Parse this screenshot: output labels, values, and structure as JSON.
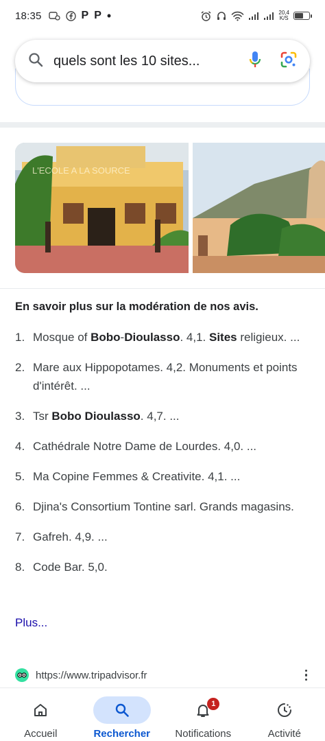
{
  "status_bar": {
    "time": "18:35",
    "app_icon_letters": [
      "P",
      "P"
    ],
    "net_speed_value": "20,4",
    "net_speed_unit": "K/S",
    "battery_level": 0.6
  },
  "search": {
    "query": "quels sont les 10 sites..."
  },
  "section": {
    "heading": "En savoir plus sur la modération de nos avis."
  },
  "results": [
    {
      "num": "1.",
      "parts": [
        {
          "t": "Mosque of "
        },
        {
          "t": "Bobo",
          "b": true
        },
        {
          "t": "-"
        },
        {
          "t": "Dioulasso",
          "b": true
        },
        {
          "t": ". 4,1. "
        },
        {
          "t": "Sites",
          "b": true
        },
        {
          "t": " religieux. ..."
        }
      ]
    },
    {
      "num": "2.",
      "parts": [
        {
          "t": "Mare aux Hippopotames. 4,2. Monuments et points d'intérêt. ..."
        }
      ]
    },
    {
      "num": "3.",
      "parts": [
        {
          "t": "Tsr "
        },
        {
          "t": "Bobo Dioulasso",
          "b": true
        },
        {
          "t": ". 4,7. ..."
        }
      ]
    },
    {
      "num": "4.",
      "parts": [
        {
          "t": "Cathédrale Notre Dame de Lourdes. 4,0. ..."
        }
      ]
    },
    {
      "num": "5.",
      "parts": [
        {
          "t": "Ma Copine Femmes & Creativite. 4,1. ..."
        }
      ]
    },
    {
      "num": "6.",
      "parts": [
        {
          "t": "Djina's Consortium Tontine sarl. Grands magasins."
        }
      ]
    },
    {
      "num": "7.",
      "parts": [
        {
          "t": "Gafreh. 4,9. ..."
        }
      ]
    },
    {
      "num": "8.",
      "parts": [
        {
          "t": "Code Bar. 5,0."
        }
      ]
    }
  ],
  "more_link": "Plus...",
  "source": {
    "url": "https://www.tripadvisor.fr",
    "favicon": "tripadvisor-owl-icon"
  },
  "bottom_nav": {
    "tabs": [
      {
        "label": "Accueil",
        "icon": "home-icon",
        "active": false
      },
      {
        "label": "Rechercher",
        "icon": "search-icon",
        "active": true
      },
      {
        "label": "Notifications",
        "icon": "bell-icon",
        "active": false,
        "badge": "1"
      },
      {
        "label": "Activité",
        "icon": "activity-icon",
        "active": false
      }
    ]
  },
  "colors": {
    "accent": "#0b57d0",
    "active_pill": "#d3e3fd",
    "badge": "#c5221f",
    "link": "#1a0dab"
  }
}
